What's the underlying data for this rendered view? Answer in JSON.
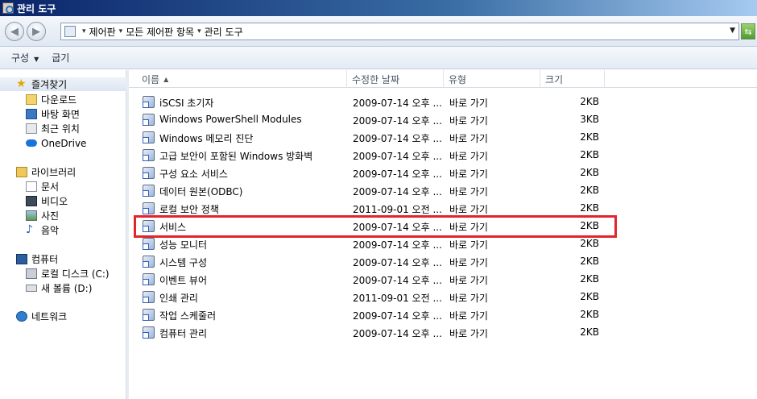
{
  "window": {
    "title": "관리 도구"
  },
  "address": {
    "crumbs": [
      "제어판",
      "모든 제어판 항목",
      "관리 도구"
    ],
    "separator": "▾"
  },
  "toolbar": {
    "organize": "구성",
    "burn": "굽기"
  },
  "nav": {
    "favorites": "즐겨찾기",
    "downloads": "다운로드",
    "desktop": "바탕 화면",
    "recent": "최근 위치",
    "onedrive": "OneDrive",
    "libraries": "라이브러리",
    "documents": "문서",
    "videos": "비디오",
    "pictures": "사진",
    "music": "음악",
    "computer": "컴퓨터",
    "local_disk": "로컬 디스크 (C:)",
    "new_volume": "새 볼륨 (D:)",
    "network": "네트워크"
  },
  "columns": {
    "name": "이름",
    "date": "수정한 날짜",
    "type": "유형",
    "size": "크기"
  },
  "files": [
    {
      "name": "iSCSI 초기자",
      "date": "2009-07-14 오후 ...",
      "type": "바로 가기",
      "size": "2KB"
    },
    {
      "name": "Windows PowerShell Modules",
      "date": "2009-07-14 오후 ...",
      "type": "바로 가기",
      "size": "3KB"
    },
    {
      "name": "Windows 메모리 진단",
      "date": "2009-07-14 오후 ...",
      "type": "바로 가기",
      "size": "2KB"
    },
    {
      "name": "고급 보안이 포함된 Windows 방화벽",
      "date": "2009-07-14 오후 ...",
      "type": "바로 가기",
      "size": "2KB"
    },
    {
      "name": "구성 요소 서비스",
      "date": "2009-07-14 오후 ...",
      "type": "바로 가기",
      "size": "2KB"
    },
    {
      "name": "데이터 원본(ODBC)",
      "date": "2009-07-14 오후 ...",
      "type": "바로 가기",
      "size": "2KB"
    },
    {
      "name": "로컬 보안 정책",
      "date": "2011-09-01 오전 ...",
      "type": "바로 가기",
      "size": "2KB"
    },
    {
      "name": "서비스",
      "date": "2009-07-14 오후 ...",
      "type": "바로 가기",
      "size": "2KB"
    },
    {
      "name": "성능 모니터",
      "date": "2009-07-14 오후 ...",
      "type": "바로 가기",
      "size": "2KB"
    },
    {
      "name": "시스템 구성",
      "date": "2009-07-14 오후 ...",
      "type": "바로 가기",
      "size": "2KB"
    },
    {
      "name": "이벤트 뷰어",
      "date": "2009-07-14 오후 ...",
      "type": "바로 가기",
      "size": "2KB"
    },
    {
      "name": "인쇄 관리",
      "date": "2011-09-01 오전 ...",
      "type": "바로 가기",
      "size": "2KB"
    },
    {
      "name": "작업 스케줄러",
      "date": "2009-07-14 오후 ...",
      "type": "바로 가기",
      "size": "2KB"
    },
    {
      "name": "컴퓨터 관리",
      "date": "2009-07-14 오후 ...",
      "type": "바로 가기",
      "size": "2KB"
    }
  ],
  "highlight_color": "#e3242b"
}
